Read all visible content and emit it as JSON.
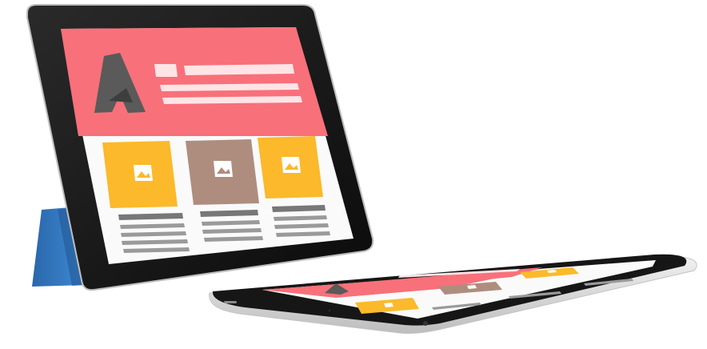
{
  "scene": {
    "description_tag": "tablet-mockups",
    "colors": {
      "background": "#ffffff",
      "bezel": "#141414",
      "screen_bg": "#fafafa",
      "hero": "#f8707a",
      "hero_light": "#ffe4e6",
      "logo": "#5a5a5a",
      "tile_yellow": "#fbb92b",
      "tile_taupe": "#ae8d7f",
      "text_bar": "#9a9a9a",
      "cover": "#2f78c4",
      "silver": "#d9d9d9"
    },
    "tiles": [
      {
        "color_key": "tile_yellow",
        "icon": "image-icon"
      },
      {
        "color_key": "tile_taupe",
        "icon": "image-icon"
      },
      {
        "color_key": "tile_yellow",
        "icon": "image-icon"
      }
    ]
  }
}
